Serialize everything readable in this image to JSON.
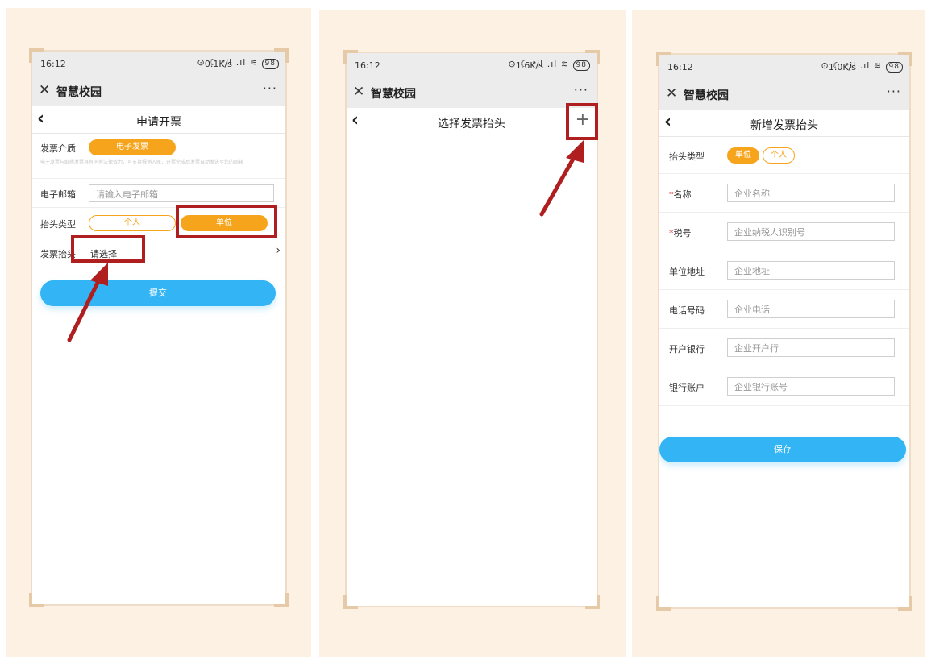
{
  "status": {
    "time": "16:12",
    "battery": "98",
    "speed1": "0.1K/s",
    "speed2": "1.6K/s",
    "speed3": "1.0K/s",
    "signal_icons": "⊙ ☾ ᵊil .ıl ≋"
  },
  "app": {
    "close": "✕",
    "title": "智慧校园",
    "more": "···"
  },
  "screen1": {
    "title": "申请开票",
    "medium_label": "发票介质",
    "medium_value": "电子发票",
    "hint": "电子发票与纸质发票具有同等法律效力，可支持报销入账，开票完成后发票自动发送至您的邮箱",
    "email_label": "电子邮箱",
    "email_placeholder": "请输入电子邮箱",
    "type_label": "抬头类型",
    "type_personal": "个人",
    "type_company": "单位",
    "header_label": "发票抬头",
    "header_value": "请选择",
    "chevron": "›",
    "submit": "提交"
  },
  "screen2": {
    "title": "选择发票抬头",
    "add": "+"
  },
  "screen3": {
    "title": "新增发票抬头",
    "type_label": "抬头类型",
    "type_company": "单位",
    "type_personal": "个人",
    "fields": [
      {
        "label": "名称",
        "required": "*",
        "placeholder": "企业名称"
      },
      {
        "label": "税号",
        "required": "*",
        "placeholder": "企业纳税人识别号"
      },
      {
        "label": "单位地址",
        "required": "",
        "placeholder": "企业地址"
      },
      {
        "label": "电话号码",
        "required": "",
        "placeholder": "企业电话"
      },
      {
        "label": "开户银行",
        "required": "",
        "placeholder": "企业开户行"
      },
      {
        "label": "银行账户",
        "required": "",
        "placeholder": "企业银行账号"
      }
    ],
    "save": "保存"
  },
  "colors": {
    "accent": "#f7a41d",
    "button": "#33b4f4",
    "annotation": "#b01f1f",
    "panel_bg": "#fdf1e3"
  },
  "icons": {
    "close": "close-icon",
    "back": "chevron-left-icon",
    "more": "more-icon",
    "add": "plus-icon",
    "arrow": "annotation-arrow"
  }
}
